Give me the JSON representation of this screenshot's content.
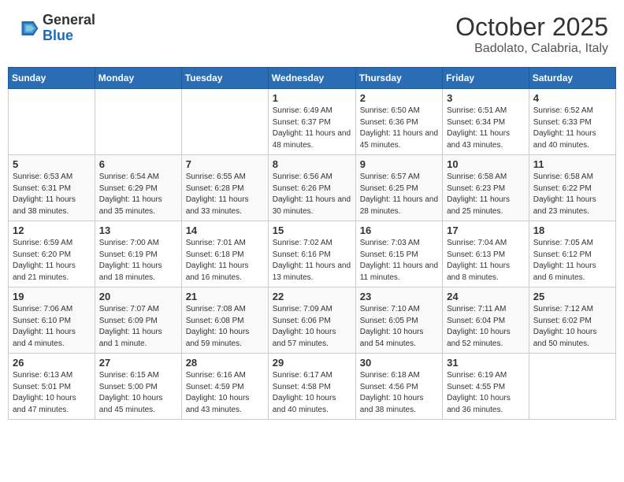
{
  "header": {
    "logo_general": "General",
    "logo_blue": "Blue",
    "month": "October 2025",
    "location": "Badolato, Calabria, Italy"
  },
  "days_of_week": [
    "Sunday",
    "Monday",
    "Tuesday",
    "Wednesday",
    "Thursday",
    "Friday",
    "Saturday"
  ],
  "weeks": [
    [
      {
        "day": "",
        "info": ""
      },
      {
        "day": "",
        "info": ""
      },
      {
        "day": "",
        "info": ""
      },
      {
        "day": "1",
        "info": "Sunrise: 6:49 AM\nSunset: 6:37 PM\nDaylight: 11 hours and 48 minutes."
      },
      {
        "day": "2",
        "info": "Sunrise: 6:50 AM\nSunset: 6:36 PM\nDaylight: 11 hours and 45 minutes."
      },
      {
        "day": "3",
        "info": "Sunrise: 6:51 AM\nSunset: 6:34 PM\nDaylight: 11 hours and 43 minutes."
      },
      {
        "day": "4",
        "info": "Sunrise: 6:52 AM\nSunset: 6:33 PM\nDaylight: 11 hours and 40 minutes."
      }
    ],
    [
      {
        "day": "5",
        "info": "Sunrise: 6:53 AM\nSunset: 6:31 PM\nDaylight: 11 hours and 38 minutes."
      },
      {
        "day": "6",
        "info": "Sunrise: 6:54 AM\nSunset: 6:29 PM\nDaylight: 11 hours and 35 minutes."
      },
      {
        "day": "7",
        "info": "Sunrise: 6:55 AM\nSunset: 6:28 PM\nDaylight: 11 hours and 33 minutes."
      },
      {
        "day": "8",
        "info": "Sunrise: 6:56 AM\nSunset: 6:26 PM\nDaylight: 11 hours and 30 minutes."
      },
      {
        "day": "9",
        "info": "Sunrise: 6:57 AM\nSunset: 6:25 PM\nDaylight: 11 hours and 28 minutes."
      },
      {
        "day": "10",
        "info": "Sunrise: 6:58 AM\nSunset: 6:23 PM\nDaylight: 11 hours and 25 minutes."
      },
      {
        "day": "11",
        "info": "Sunrise: 6:58 AM\nSunset: 6:22 PM\nDaylight: 11 hours and 23 minutes."
      }
    ],
    [
      {
        "day": "12",
        "info": "Sunrise: 6:59 AM\nSunset: 6:20 PM\nDaylight: 11 hours and 21 minutes."
      },
      {
        "day": "13",
        "info": "Sunrise: 7:00 AM\nSunset: 6:19 PM\nDaylight: 11 hours and 18 minutes."
      },
      {
        "day": "14",
        "info": "Sunrise: 7:01 AM\nSunset: 6:18 PM\nDaylight: 11 hours and 16 minutes."
      },
      {
        "day": "15",
        "info": "Sunrise: 7:02 AM\nSunset: 6:16 PM\nDaylight: 11 hours and 13 minutes."
      },
      {
        "day": "16",
        "info": "Sunrise: 7:03 AM\nSunset: 6:15 PM\nDaylight: 11 hours and 11 minutes."
      },
      {
        "day": "17",
        "info": "Sunrise: 7:04 AM\nSunset: 6:13 PM\nDaylight: 11 hours and 8 minutes."
      },
      {
        "day": "18",
        "info": "Sunrise: 7:05 AM\nSunset: 6:12 PM\nDaylight: 11 hours and 6 minutes."
      }
    ],
    [
      {
        "day": "19",
        "info": "Sunrise: 7:06 AM\nSunset: 6:10 PM\nDaylight: 11 hours and 4 minutes."
      },
      {
        "day": "20",
        "info": "Sunrise: 7:07 AM\nSunset: 6:09 PM\nDaylight: 11 hours and 1 minute."
      },
      {
        "day": "21",
        "info": "Sunrise: 7:08 AM\nSunset: 6:08 PM\nDaylight: 10 hours and 59 minutes."
      },
      {
        "day": "22",
        "info": "Sunrise: 7:09 AM\nSunset: 6:06 PM\nDaylight: 10 hours and 57 minutes."
      },
      {
        "day": "23",
        "info": "Sunrise: 7:10 AM\nSunset: 6:05 PM\nDaylight: 10 hours and 54 minutes."
      },
      {
        "day": "24",
        "info": "Sunrise: 7:11 AM\nSunset: 6:04 PM\nDaylight: 10 hours and 52 minutes."
      },
      {
        "day": "25",
        "info": "Sunrise: 7:12 AM\nSunset: 6:02 PM\nDaylight: 10 hours and 50 minutes."
      }
    ],
    [
      {
        "day": "26",
        "info": "Sunrise: 6:13 AM\nSunset: 5:01 PM\nDaylight: 10 hours and 47 minutes."
      },
      {
        "day": "27",
        "info": "Sunrise: 6:15 AM\nSunset: 5:00 PM\nDaylight: 10 hours and 45 minutes."
      },
      {
        "day": "28",
        "info": "Sunrise: 6:16 AM\nSunset: 4:59 PM\nDaylight: 10 hours and 43 minutes."
      },
      {
        "day": "29",
        "info": "Sunrise: 6:17 AM\nSunset: 4:58 PM\nDaylight: 10 hours and 40 minutes."
      },
      {
        "day": "30",
        "info": "Sunrise: 6:18 AM\nSunset: 4:56 PM\nDaylight: 10 hours and 38 minutes."
      },
      {
        "day": "31",
        "info": "Sunrise: 6:19 AM\nSunset: 4:55 PM\nDaylight: 10 hours and 36 minutes."
      },
      {
        "day": "",
        "info": ""
      }
    ]
  ]
}
